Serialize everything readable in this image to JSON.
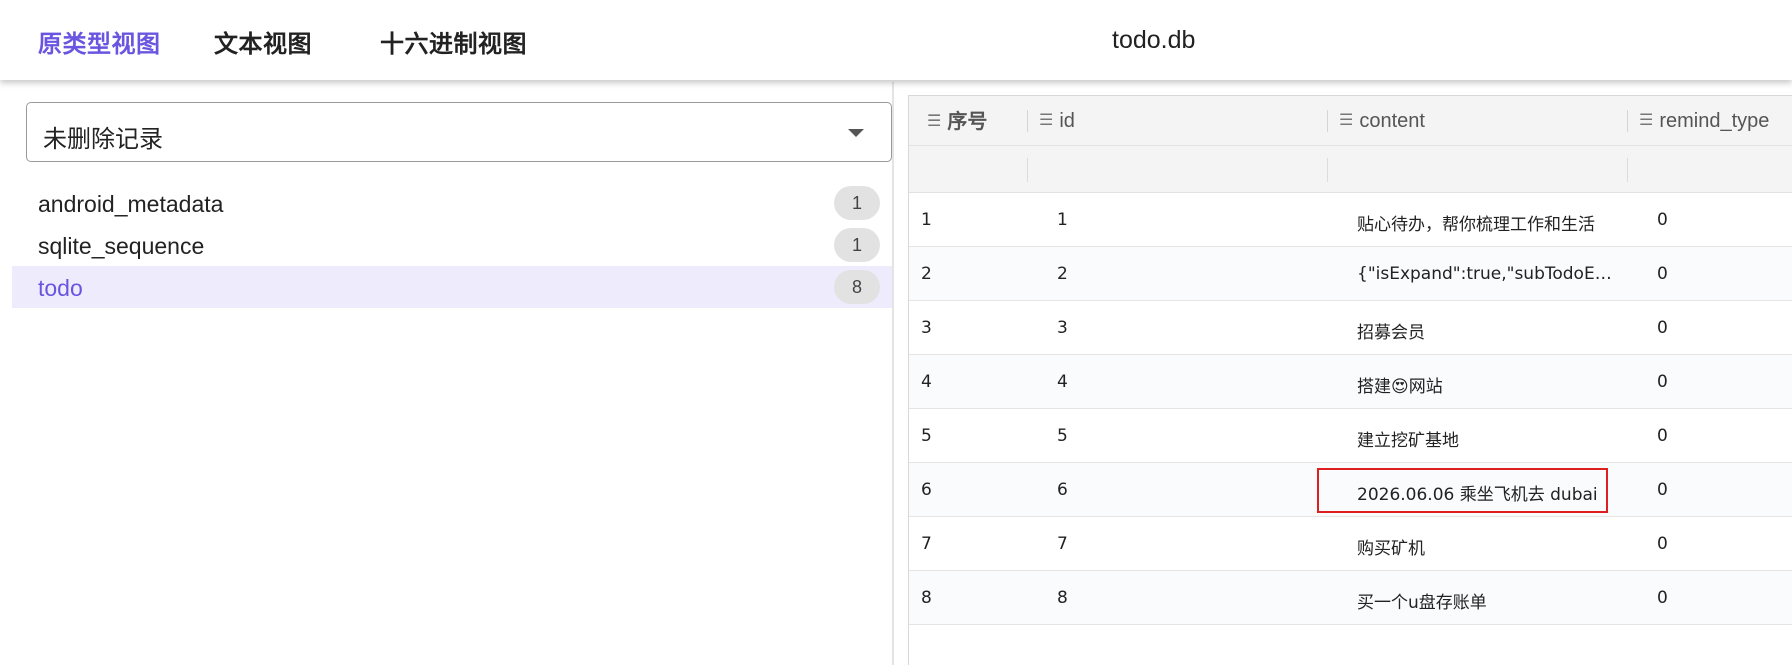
{
  "header": {
    "tabs": [
      {
        "label": "原类型视图",
        "active": true
      },
      {
        "label": "文本视图",
        "active": false
      },
      {
        "label": "十六进制视图",
        "active": false
      }
    ],
    "title": "todo.db"
  },
  "sidebar": {
    "filter": {
      "selected": "未删除记录"
    },
    "tables": [
      {
        "name": "android_metadata",
        "count": "1",
        "active": false
      },
      {
        "name": "sqlite_sequence",
        "count": "1",
        "active": false
      },
      {
        "name": "todo",
        "count": "8",
        "active": true
      }
    ]
  },
  "grid": {
    "columns": [
      "序号",
      "id",
      "content",
      "remind_type"
    ],
    "rows": [
      [
        "1",
        "1",
        "贴心待办，帮你梳理工作和生活",
        "0"
      ],
      [
        "2",
        "2",
        "{\"isExpand\":true,\"subTodoEntities\"",
        "0"
      ],
      [
        "3",
        "3",
        "招募会员",
        "0"
      ],
      [
        "4",
        "4",
        "搭建😍网站",
        "0"
      ],
      [
        "5",
        "5",
        "建立挖矿基地",
        "0"
      ],
      [
        "6",
        "6",
        "2026.06.06 乘坐飞机去 dubai",
        "0"
      ],
      [
        "7",
        "7",
        "购买矿机",
        "0"
      ],
      [
        "8",
        "8",
        "买一个u盘存账单",
        "0"
      ]
    ]
  },
  "colors": {
    "accent": "#6a55e0",
    "active_row": "#eeebfc",
    "highlight": "#dd1f1f",
    "header_bg": "#f3f4f3"
  },
  "icons": {
    "column_header": "list-bars-icon",
    "dropdown": "chevron-down-icon"
  }
}
